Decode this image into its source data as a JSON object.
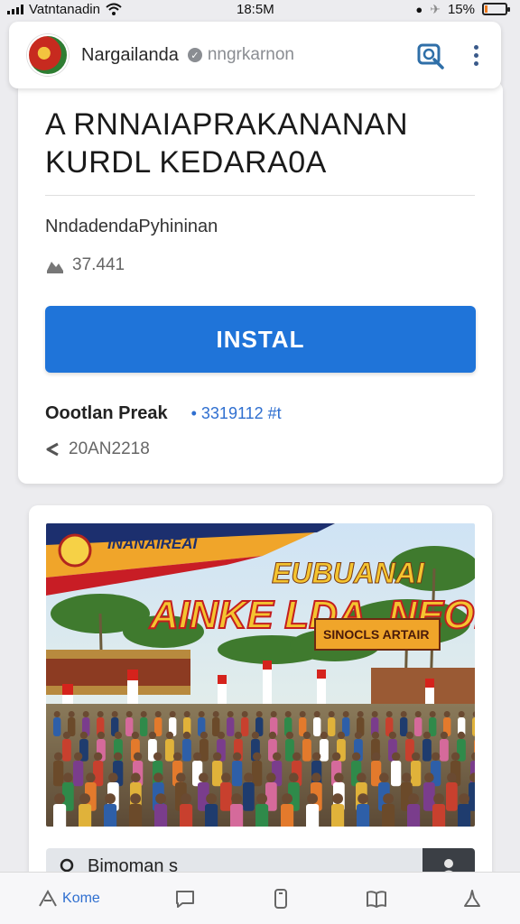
{
  "status_bar": {
    "carrier": "Vatntanadin",
    "time": "18:5M",
    "battery": "15%",
    "battery_level": 0.15
  },
  "header": {
    "site_name": "Nargailanda",
    "handle": "nngrkarnon",
    "verified_icon": "check-badge-icon",
    "search_icon": "search-icon",
    "more_icon": "more-vertical-icon"
  },
  "app": {
    "title_line1": "A RNNAIAPRAKANANAN",
    "title_line2": "KURDL KEDARA0A",
    "subtitle": "NndadendaPyhininan",
    "downloads": "37.441",
    "install_label": "INSTAL",
    "developer": "Oootlan Preak",
    "developer_id": "• 3319112 #t",
    "date": "20AN2218"
  },
  "banner": {
    "ribbon_text": "INANAIREAI",
    "headline_top": "EUBUANAI",
    "headline_main": "AINKE LDA_NEOI",
    "tagline": "SINOCLS ARTAIR",
    "caption": "Bimoman s"
  },
  "bottom_nav": {
    "home_label": "Kome"
  },
  "colors": {
    "accent": "#1f74d9",
    "link": "#2f6fd0",
    "battery": "#f07a1d"
  }
}
